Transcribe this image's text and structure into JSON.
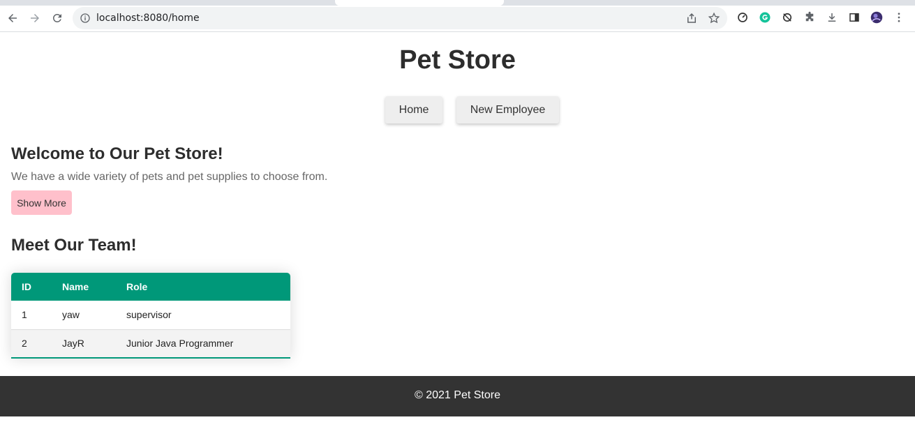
{
  "browser": {
    "url": "localhost:8080/home",
    "icons": [
      "back-arrow-icon",
      "forward-arrow-icon",
      "reload-icon",
      "info-icon",
      "share-icon",
      "bookmark-star-icon",
      "speedometer-icon",
      "grammarly-icon",
      "sync-icon",
      "extensions-puzzle-icon",
      "download-icon",
      "side-panel-icon",
      "profile-avatar-icon",
      "kebab-menu-icon"
    ]
  },
  "header": {
    "title": "Pet Store"
  },
  "nav": {
    "home_label": "Home",
    "new_employee_label": "New Employee"
  },
  "welcome": {
    "heading": "Welcome to Our Pet Store!",
    "text": "We have a wide variety of pets and pet supplies to choose from.",
    "show_more_label": "Show More"
  },
  "team": {
    "heading": "Meet Our Team!",
    "columns": [
      "ID",
      "Name",
      "Role"
    ],
    "rows": [
      [
        "1",
        "yaw",
        "supervisor"
      ],
      [
        "2",
        "JayR",
        "Junior Java Programmer"
      ]
    ]
  },
  "footer": {
    "text": "© 2021 Pet Store"
  },
  "colors": {
    "table_header": "#009879",
    "show_more_bg": "#ffc0cb",
    "footer_bg": "#333333"
  }
}
